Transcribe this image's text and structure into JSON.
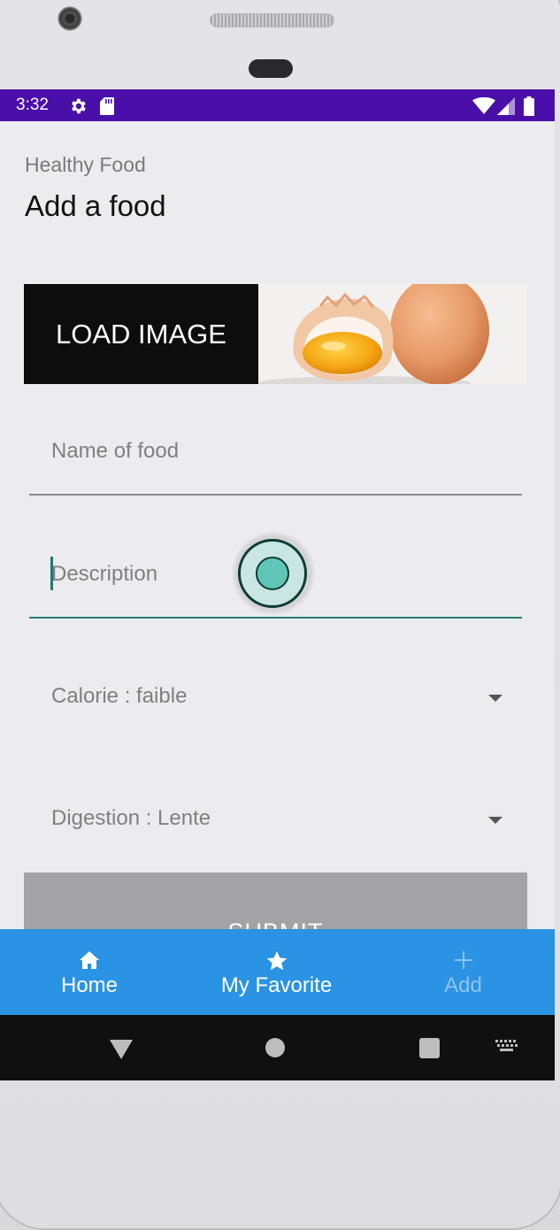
{
  "status_bar": {
    "time": "3:32",
    "icons": [
      "settings-gear-icon",
      "sd-card-icon",
      "wifi-icon",
      "signal-icon",
      "battery-icon"
    ],
    "color": "#4a0fa8"
  },
  "header": {
    "subtitle": "Healthy Food",
    "title": "Add a food"
  },
  "image_section": {
    "load_button_label": "LOAD IMAGE",
    "image_subject": "eggs"
  },
  "form": {
    "name_placeholder": "Name of food",
    "name_value": "",
    "description_placeholder": "Description",
    "description_value": "",
    "calorie_selected": "Calorie : faible",
    "digestion_selected": "Digestion : Lente",
    "submit_label": "SUBMIT",
    "accent_color": "#1e7a72"
  },
  "bottom_nav": {
    "items": [
      {
        "label": "Home",
        "icon": "home-icon"
      },
      {
        "label": "My Favorite",
        "icon": "star-icon"
      },
      {
        "label": "Add",
        "icon": "plus-icon"
      }
    ],
    "color": "#2a93e4"
  },
  "system_nav": {
    "icons": [
      "back-icon",
      "home-circle-icon",
      "recents-icon",
      "keyboard-icon"
    ]
  }
}
